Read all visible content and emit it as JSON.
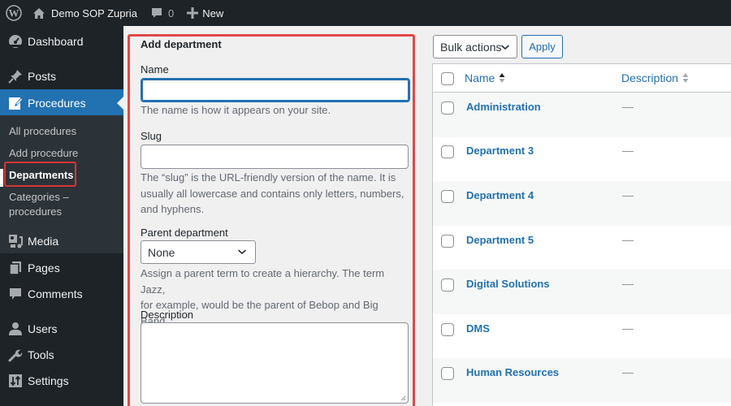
{
  "adminbar": {
    "site_name": "Demo SOP Zupria",
    "comments_count": "0",
    "new_label": "New"
  },
  "sidebar": {
    "items": [
      {
        "label": "Dashboard",
        "icon": "dashboard-icon"
      },
      {
        "label": "Posts",
        "icon": "pin-icon"
      },
      {
        "label": "Procedures",
        "icon": "edit-page-icon",
        "active": true
      },
      {
        "label": "Media",
        "icon": "media-icon"
      },
      {
        "label": "Pages",
        "icon": "pages-icon"
      },
      {
        "label": "Comments",
        "icon": "comment-icon"
      },
      {
        "label": "Users",
        "icon": "user-icon"
      },
      {
        "label": "Tools",
        "icon": "wrench-icon"
      },
      {
        "label": "Settings",
        "icon": "settings-icon"
      }
    ],
    "submenu": [
      {
        "label": "All procedures"
      },
      {
        "label": "Add procedure"
      },
      {
        "label": "Departments",
        "current": true
      },
      {
        "label": "Categories –"
      },
      {
        "label": "procedures"
      }
    ]
  },
  "form": {
    "title": "Add department",
    "name_label": "Name",
    "name_value": "",
    "name_help": "The name is how it appears on your site.",
    "slug_label": "Slug",
    "slug_value": "",
    "slug_help_1": "The “slug” is the URL-friendly version of the name. It is",
    "slug_help_2": "usually all lowercase and contains only letters, numbers,",
    "slug_help_3": "and hyphens.",
    "parent_label": "Parent department",
    "parent_value": "None",
    "parent_help_1": "Assign a parent term to create a hierarchy. The term Jazz,",
    "parent_help_2": "for example, would be the parent of Bebop and Big Band.",
    "description_label": "Description",
    "description_value": ""
  },
  "list": {
    "bulk_actions_label": "Bulk actions",
    "apply_label": "Apply",
    "columns": [
      {
        "label": "Name",
        "sorted": "asc"
      },
      {
        "label": "Description",
        "sorted": "none"
      }
    ],
    "rows": [
      {
        "name": "Administration",
        "description": "—"
      },
      {
        "name": "Department 3",
        "description": "—"
      },
      {
        "name": "Department 4",
        "description": "—"
      },
      {
        "name": "Department 5",
        "description": "—"
      },
      {
        "name": "Digital Solutions",
        "description": "—"
      },
      {
        "name": "DMS",
        "description": "—"
      },
      {
        "name": "Human Resources",
        "description": "—"
      }
    ]
  },
  "colors": {
    "accent": "#2271b1",
    "highlight_border": "#e04848",
    "adminbar_bg": "#1d2327"
  }
}
